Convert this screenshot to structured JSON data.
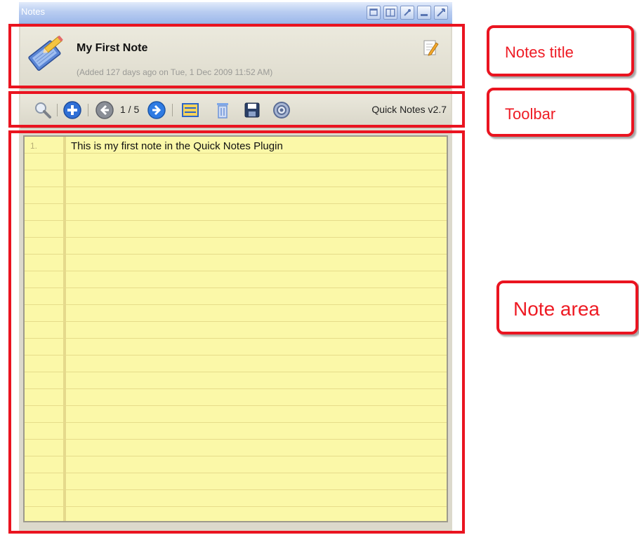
{
  "window": {
    "title": "Notes"
  },
  "header": {
    "note_title": "My First Note",
    "added_text": "(Added 127 days ago on Tue, 1 Dec 2009 11:52 AM)"
  },
  "toolbar": {
    "page_indicator": "1 / 5",
    "version": "Quick Notes v2.7",
    "icons": [
      "search-icon",
      "add-icon",
      "previous-icon",
      "next-icon",
      "list-icon",
      "trash-icon",
      "save-icon",
      "settings-icon"
    ]
  },
  "note": {
    "line_number": "1.",
    "text": "This is my first note in the Quick Notes Plugin"
  },
  "annotations": {
    "title_label": "Notes title",
    "toolbar_label": "Toolbar",
    "note_area_label": "Note area"
  },
  "colors": {
    "annotation_red": "#ea1420",
    "note_paper": "#fbf8a8",
    "titlebar_blue": "#b9cdf1"
  }
}
